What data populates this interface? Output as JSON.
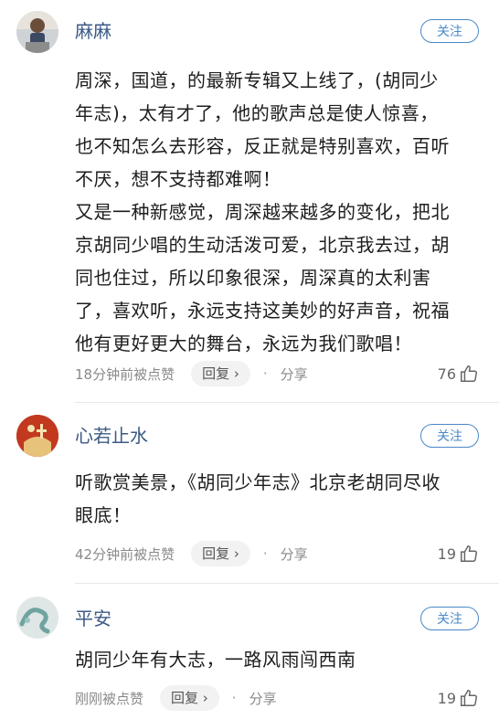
{
  "comments": [
    {
      "username": "麻麻",
      "follow_label": "关注",
      "text": "周深，国道，的最新专辑又上线了，(胡同少\n年志)，太有才了，他的歌声总是使人惊喜，\n也不知怎么去形容，反正就是特别喜欢，百听\n不厌，想不支持都难啊！\n又是一种新感觉，周深越来越多的变化，把北\n京胡同少唱的生动活泼可爱，北京我去过，胡\n同也住过，所以印象很深，周深真的太利害\n了，喜欢听，永远支持这美妙的好声音，祝福\n他有更好更大的舞台，永远为我们歌唱！",
      "time": "18分钟前被点赞",
      "reply_label": "回复 ›",
      "share_label": "分享",
      "likes": "76"
    },
    {
      "username": "心若止水",
      "follow_label": "关注",
      "text": "听歌赏美景，《胡同少年志》北京老胡同尽收\n眼底！",
      "time": "42分钟前被点赞",
      "reply_label": "回复 ›",
      "share_label": "分享",
      "likes": "19"
    },
    {
      "username": "平安",
      "follow_label": "关注",
      "text": "胡同少年有大志，一路风雨闯西南",
      "time": "刚刚被点赞",
      "reply_label": "回复 ›",
      "share_label": "分享",
      "likes": "19"
    }
  ]
}
